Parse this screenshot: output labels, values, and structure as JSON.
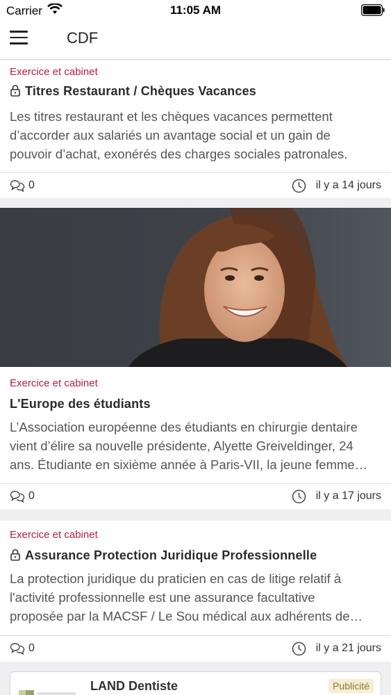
{
  "status_bar": {
    "carrier": "Carrier",
    "time": "11:05 AM"
  },
  "nav": {
    "title": "CDF"
  },
  "articles": [
    {
      "category": "Exercice et cabinet",
      "title": "Titres Restaurant / Chèques Vacances",
      "locked": true,
      "excerpt_lines": [
        "Les titres restaurant et les chèques vacances permettent",
        "d’accorder aux salariés un avantage social et un gain de",
        "pouvoir d’achat, exonérés des charges sociales patronales."
      ],
      "comments": "0",
      "time_ago": "il y a 14 jours"
    },
    {
      "category": "Exercice et cabinet",
      "title": "L'Europe des étudiants",
      "locked": false,
      "has_image": true,
      "excerpt_lines": [
        "L’Association européenne des étudiants en chirurgie dentaire",
        "vient d’élire sa nouvelle présidente, Alyette Greiveldinger, 24",
        "ans. Étudiante en sixième année à Paris-VII, la jeune femme…"
      ],
      "comments": "0",
      "time_ago": "il y a 17 jours"
    },
    {
      "category": "Exercice et cabinet",
      "title": "Assurance Protection Juridique Professionnelle",
      "locked": true,
      "excerpt_lines": [
        "La protection juridique du praticien en cas de litige relatif à",
        "l'activité professionnelle est une assurance facultative",
        "proposée par la MACSF / Le Sou médical aux adhérents de…"
      ],
      "comments": "0",
      "time_ago": "il y a 21 jours"
    }
  ],
  "ad": {
    "title": "LAND Dentiste",
    "badge": "Publicité"
  },
  "colors": {
    "category": "#b3203f",
    "background": "#efeff1"
  },
  "icons": [
    "wifi-icon",
    "battery-icon",
    "menu-icon",
    "lock-icon",
    "comment-icon",
    "clock-icon"
  ]
}
